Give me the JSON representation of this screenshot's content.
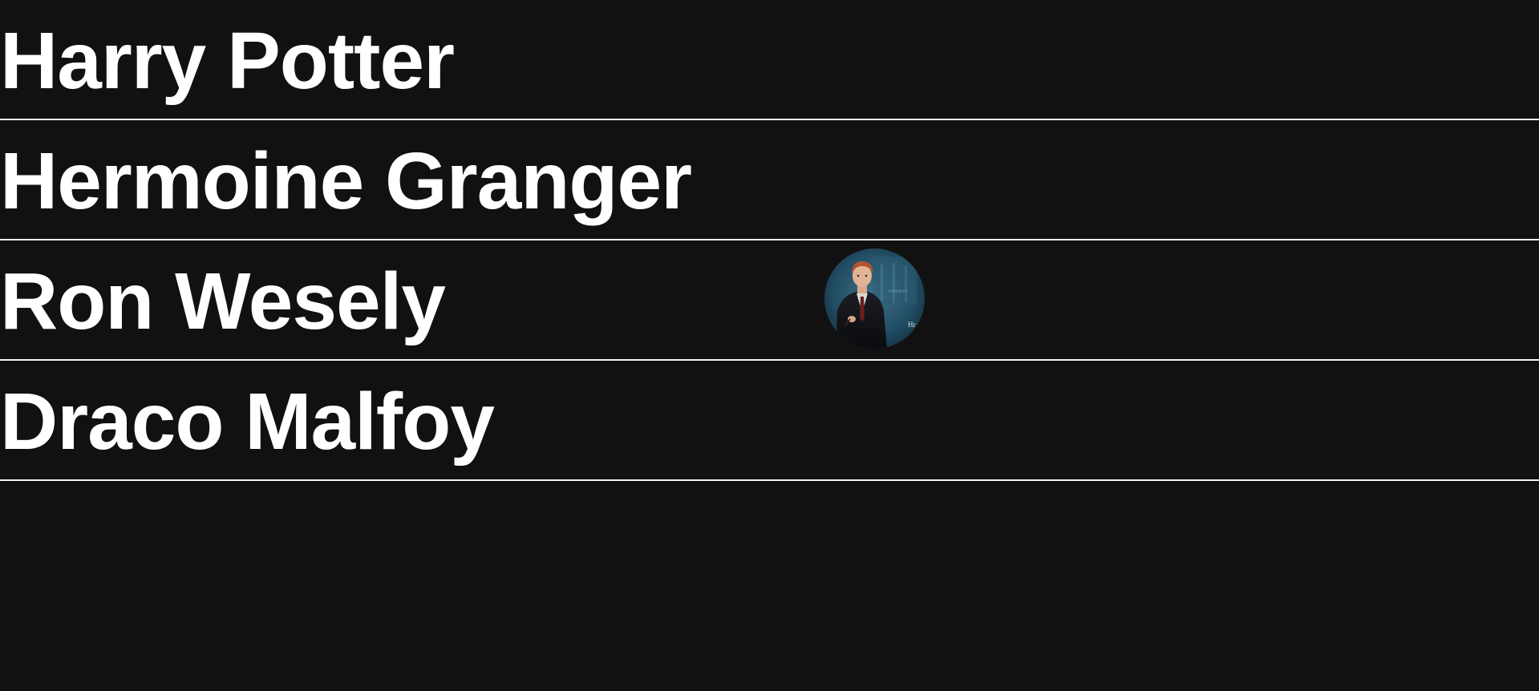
{
  "characters": [
    {
      "name": "Harry Potter"
    },
    {
      "name": "Hermoine Granger"
    },
    {
      "name": "Ron Wesely"
    },
    {
      "name": "Draco Malfoy"
    }
  ],
  "hover_preview": {
    "for": "Ron Wesely"
  },
  "colors": {
    "background": "#111111",
    "text": "#ffffff",
    "divider": "#f2f2f2"
  }
}
